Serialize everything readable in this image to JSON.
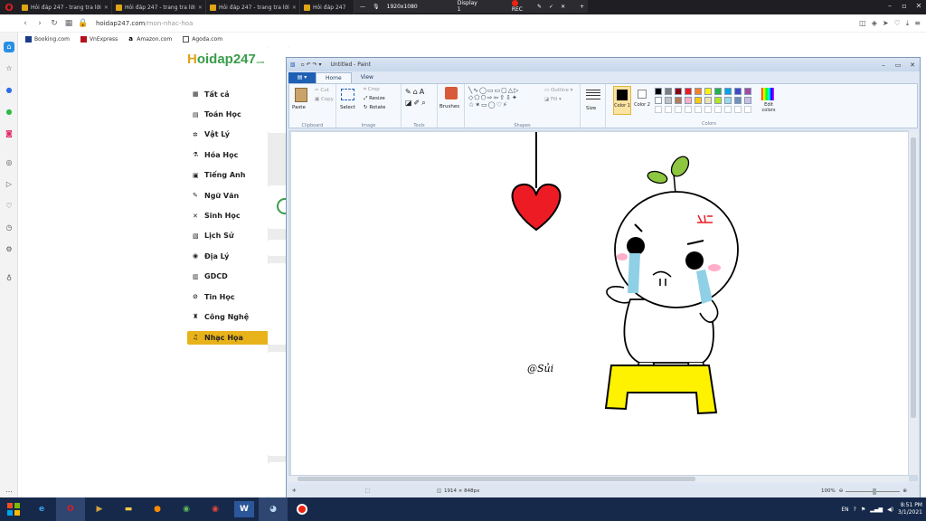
{
  "browser": {
    "tabs": [
      {
        "title": "Hỏi đáp 247 - trang tra lời"
      },
      {
        "title": "Hỏi đáp 247 - trang tra lời"
      },
      {
        "title": "Hỏi đáp 247 - trang tra lời"
      },
      {
        "title": "Hỏi đáp 247"
      }
    ],
    "url_domain": "hoidap247.com",
    "url_path": "/mon-nhac-hoa",
    "bookmarks": [
      "Booking.com",
      "VnExpress",
      "Amazon.com",
      "Agoda.com"
    ]
  },
  "recorder": {
    "resolution": "1920x1080",
    "display": "Display 1",
    "rec_label": "REC"
  },
  "site": {
    "logo_main": "H",
    "logo_rest": "oidap247",
    "logo_sub": ".com",
    "menu": [
      {
        "icon": "grid-icon",
        "glyph": "▦",
        "label": "Tất cả"
      },
      {
        "icon": "book-icon",
        "glyph": "▤",
        "label": "Toán Học"
      },
      {
        "icon": "atom-icon",
        "glyph": "✲",
        "label": "Vật Lý"
      },
      {
        "icon": "flask-icon",
        "glyph": "⚗",
        "label": "Hóa Học"
      },
      {
        "icon": "translate-icon",
        "glyph": "▣",
        "label": "Tiếng Anh"
      },
      {
        "icon": "pen-icon",
        "glyph": "✎",
        "label": "Ngữ Văn"
      },
      {
        "icon": "dna-icon",
        "glyph": "✕",
        "label": "Sinh Học"
      },
      {
        "icon": "scroll-icon",
        "glyph": "▧",
        "label": "Lịch Sử"
      },
      {
        "icon": "globe-icon",
        "glyph": "◉",
        "label": "Địa Lý"
      },
      {
        "icon": "civics-icon",
        "glyph": "▥",
        "label": "GDCD"
      },
      {
        "icon": "computer-icon",
        "glyph": "⊘",
        "label": "Tin Học"
      },
      {
        "icon": "tech-icon",
        "glyph": "♜",
        "label": "Công Nghệ"
      },
      {
        "icon": "music-icon",
        "glyph": "♫",
        "label": "Nhạc Họa",
        "active": true
      }
    ],
    "accent": "#e8b21a"
  },
  "paint": {
    "title": "Untitled - Paint",
    "file_tab": "▤ ▾",
    "tabs": [
      "Home",
      "View"
    ],
    "groups": {
      "clipboard": "Clipboard",
      "image": "Image",
      "tools": "Tools",
      "shapes": "Shapes",
      "colors": "Colors"
    },
    "buttons": {
      "paste": "Paste",
      "cut": "Cut",
      "copy": "Copy",
      "select": "Select",
      "crop": "Crop",
      "resize": "Resize",
      "rotate": "Rotate",
      "brushes": "Brushes",
      "outline": "Outline",
      "fill": "Fill",
      "size": "Size",
      "color1": "Color 1",
      "color2": "Color 2",
      "edit_colors": "Edit colors"
    },
    "palette_row1": [
      "#000000",
      "#7f7f7f",
      "#880015",
      "#ed1c24",
      "#ff7f27",
      "#fff200",
      "#22b14c",
      "#00a2e8",
      "#3f48cc",
      "#a349a4"
    ],
    "palette_row2": [
      "#ffffff",
      "#c3c3c3",
      "#b97a57",
      "#ffaec9",
      "#ffc90e",
      "#efe4b0",
      "#b5e61d",
      "#99d9ea",
      "#7092be",
      "#c8bfe7"
    ],
    "canvas_signature": "@Sủi",
    "status_size": "1914 × 848px",
    "zoom": "100%"
  },
  "taskbar": {
    "apps": [
      "ie-icon",
      "opera-icon",
      "media-icon",
      "explorer-icon",
      "firefox-icon",
      "chrome-like-icon",
      "chrome-icon",
      "word-icon",
      "paint-icon",
      "recorder-icon"
    ],
    "lang": "EN",
    "time": "8:51 PM",
    "date": "3/1/2021"
  }
}
